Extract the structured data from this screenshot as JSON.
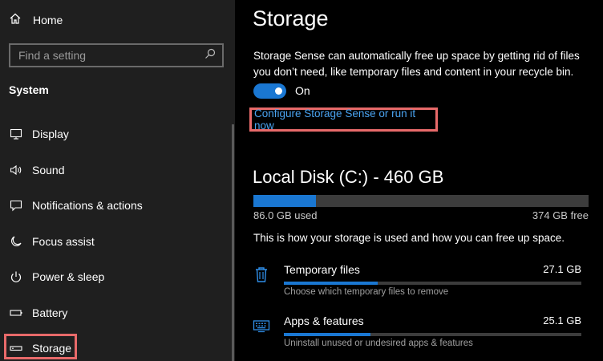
{
  "sidebar": {
    "home_label": "Home",
    "search_placeholder": "Find a setting",
    "section_title": "System",
    "items": [
      {
        "label": "Display",
        "icon": "monitor-icon"
      },
      {
        "label": "Sound",
        "icon": "speaker-icon"
      },
      {
        "label": "Notifications & actions",
        "icon": "notification-icon"
      },
      {
        "label": "Focus assist",
        "icon": "moon-icon"
      },
      {
        "label": "Power & sleep",
        "icon": "power-icon"
      },
      {
        "label": "Battery",
        "icon": "battery-icon"
      },
      {
        "label": "Storage",
        "icon": "storage-icon",
        "selected": true
      }
    ]
  },
  "main": {
    "title": "Storage",
    "description": "Storage Sense can automatically free up space by getting rid of files you don’t need, like temporary files and content in your recycle bin.",
    "toggle_state": "On",
    "configure_link": "Configure Storage Sense or run it now",
    "disk": {
      "title": "Local Disk (C:) - 460 GB",
      "used_label": "86.0 GB used",
      "free_label": "374 GB free",
      "used_fraction": 0.187
    },
    "usage_description": "This is how your storage is used and how you can free up space.",
    "categories": [
      {
        "name": "Temporary files",
        "size": "27.1 GB",
        "subtitle": "Choose which temporary files to remove",
        "fraction": 0.315,
        "icon": "trash-icon"
      },
      {
        "name": "Apps & features",
        "size": "25.1 GB",
        "subtitle": "Uninstall unused or undesired apps & features",
        "fraction": 0.292,
        "icon": "keyboard-icon"
      }
    ]
  },
  "colors": {
    "accent": "#1a77d2",
    "link": "#4aa3f0",
    "highlight": "#e86a6a",
    "sidebar_bg": "#1f1f1f",
    "main_bg": "#000000"
  }
}
